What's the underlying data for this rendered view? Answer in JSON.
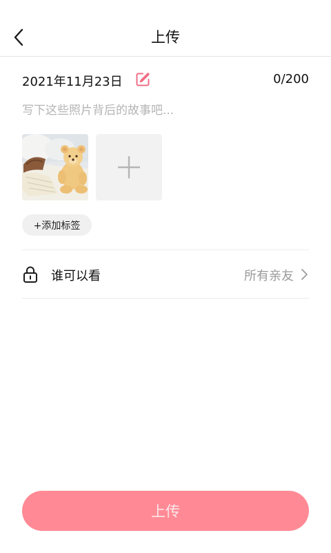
{
  "header": {
    "title": "上传",
    "back_icon": "chevron-left-icon"
  },
  "post": {
    "date": "2021年11月23日",
    "edit_icon": "edit-icon",
    "edit_icon_color": "#f06e84",
    "char_count": "0/200",
    "story_placeholder": "写下这些照片背后的故事吧...",
    "story_value": "",
    "photos": [
      {
        "name": "teddy-bear-blanket-photo"
      }
    ],
    "add_photo_icon": "plus-icon",
    "add_tag_label": "+添加标签"
  },
  "visibility": {
    "icon": "lock-icon",
    "label": "谁可以看",
    "value": "所有亲友",
    "chevron_icon": "chevron-right-icon"
  },
  "footer": {
    "upload_label": "上传",
    "upload_color": "#ff8a95"
  }
}
